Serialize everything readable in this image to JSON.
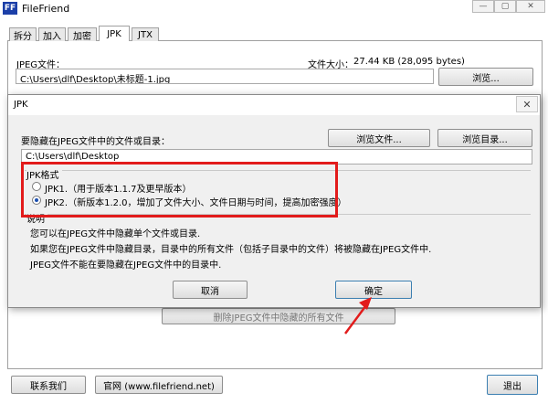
{
  "main": {
    "title": "FileFriend",
    "icon_text": "FF",
    "tabs": [
      {
        "label": "拆分"
      },
      {
        "label": "加入"
      },
      {
        "label": "加密"
      },
      {
        "label": "JPK"
      },
      {
        "label": "JTX"
      }
    ],
    "jpeg_label": "JPEG文件：",
    "filesize_label": "文件大小：",
    "filesize_value": "27.44 KB (28,095 bytes)",
    "jpeg_path": "C:\\Users\\dlf\\Desktop\\未标题-1.jpg",
    "browse_label": "浏览...",
    "remove_all_label": "删除JPEG文件中隐藏的所有文件",
    "contact_label": "联系我们",
    "website_label": "官网 (www.filefriend.net)",
    "exit_label": "退出"
  },
  "dialog": {
    "title": "JPK",
    "close_glyph": "✕",
    "hide_label": "要隐藏在JPEG文件中的文件或目录：",
    "browse_file_label": "浏览文件...",
    "browse_dir_label": "浏览目录...",
    "path_value": "C:\\Users\\dlf\\Desktop",
    "format_group_label": "JPK格式",
    "format_options": [
      {
        "label": "JPK1.（用于版本1.1.7及更早版本）",
        "selected": false
      },
      {
        "label": "JPK2.（新版本1.2.0，增加了文件大小、文件日期与时间，提高加密强度）",
        "selected": true
      }
    ],
    "desc_group_label": "说明",
    "desc_lines": [
      "您可以在JPEG文件中隐藏单个文件或目录.",
      "如果您在JPEG文件中隐藏目录，目录中的所有文件（包括子目录中的文件）将被隐藏在JPEG文件中.",
      "JPEG文件不能在要隐藏在JPEG文件中的目录中."
    ],
    "cancel_label": "取消",
    "ok_label": "确定"
  },
  "colors": {
    "highlight": "#e21b1b",
    "arrow": "#e21b1b",
    "icon_bg": "#1c3fa8"
  }
}
